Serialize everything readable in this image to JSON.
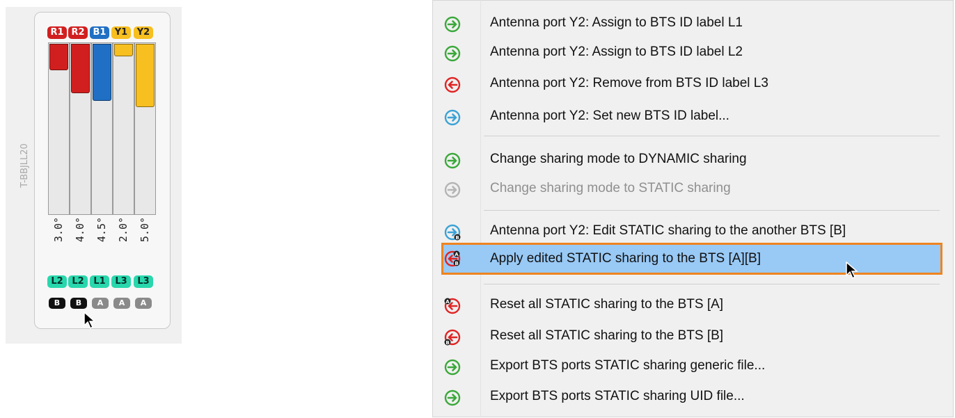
{
  "widget": {
    "title": "T-BBJLL20",
    "ports": [
      {
        "label": "R1",
        "color": "#d11f1f",
        "fill": 0.155,
        "degree": "3.0°",
        "bts_label": "L2",
        "bts": "B",
        "bts_color": "#111111"
      },
      {
        "label": "R2",
        "color": "#d11f1f",
        "fill": 0.29,
        "degree": "4.0°",
        "bts_label": "L2",
        "bts": "B",
        "bts_color": "#111111"
      },
      {
        "label": "B1",
        "color": "#1f6fc4",
        "fill": 0.335,
        "degree": "4.5°",
        "bts_label": "L1",
        "bts": "A",
        "bts_color": "#8a8a8a"
      },
      {
        "label": "Y1",
        "color": "#f7bf1f",
        "fill": 0.075,
        "degree": "2.0°",
        "bts_label": "L3",
        "bts": "A",
        "bts_color": "#8a8a8a"
      },
      {
        "label": "Y2",
        "color": "#f7bf1f",
        "fill": 0.37,
        "degree": "5.0°",
        "bts_label": "L3",
        "bts": "A",
        "bts_color": "#8a8a8a"
      }
    ]
  },
  "menu": {
    "items": [
      {
        "label": "Antenna port Y2: Assign to BTS ID label L1",
        "icon": "green-arrow-right-icon"
      },
      {
        "label": "Antenna port Y2: Assign to BTS ID label L2",
        "icon": "green-arrow-right-icon"
      },
      {
        "label": "Antenna port Y2: Remove from BTS ID label L3",
        "icon": "red-arrow-left-icon"
      },
      {
        "label": "Antenna port Y2: Set new BTS ID label...",
        "icon": "blue-arrow-right-icon"
      },
      {
        "label": "Change sharing mode to DYNAMIC sharing",
        "icon": "green-arrow-right-icon"
      },
      {
        "label": "Change sharing mode to STATIC sharing",
        "icon": "gray-arrow-right-icon",
        "disabled": true
      },
      {
        "label": "Antenna port Y2: Edit STATIC sharing to the another BTS [B]",
        "icon": "blue-arrow-right-b-icon"
      },
      {
        "label": "Apply edited STATIC sharing to the BTS [A][B]",
        "icon": "red-arrow-left-ab-icon",
        "highlighted": true
      },
      {
        "label": "Reset all STATIC sharing to the BTS [A]",
        "icon": "red-arrow-left-a-icon"
      },
      {
        "label": "Reset all STATIC sharing to the BTS [B]",
        "icon": "red-arrow-left-b-icon"
      },
      {
        "label": "Export BTS ports STATIC sharing generic file...",
        "icon": "green-arrow-right-icon"
      },
      {
        "label": "Export BTS ports STATIC sharing UID file...",
        "icon": "green-arrow-right-icon"
      }
    ]
  },
  "colors": {
    "green": "#3aa83a",
    "red": "#e02424",
    "blue": "#3aa2d6",
    "gray": "#b4b4b4",
    "highlight": "#99c9f5",
    "highlight_border": "#ee8420"
  }
}
